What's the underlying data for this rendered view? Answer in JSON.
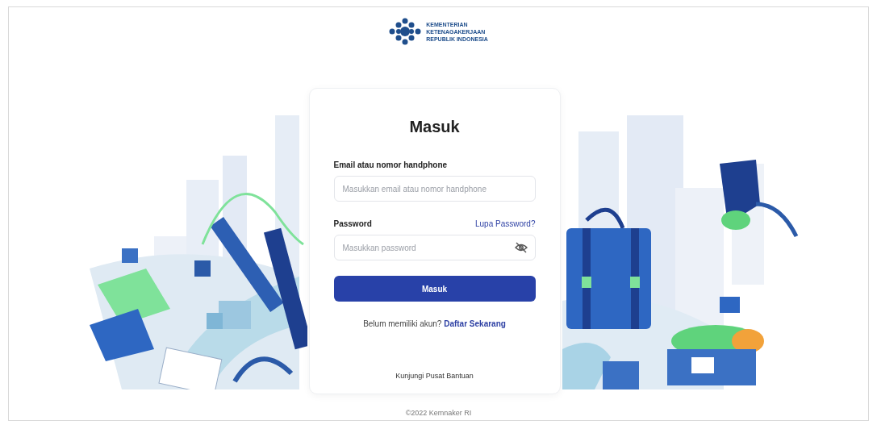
{
  "header": {
    "logo_text": [
      "KEMENTERIAN",
      "KETENAGAKERJAAN",
      "REPUBLIK INDONESIA"
    ]
  },
  "login": {
    "title": "Masuk",
    "fields": [
      {
        "kind": "text",
        "label": "Email atau nomor handphone",
        "placeholder": "Masukkan email atau nomor handphone"
      },
      {
        "kind": "password",
        "label": "Password",
        "link": "Lupa Password?",
        "placeholder": "Masukkan password"
      }
    ],
    "submit": "Masuk",
    "register_prompt": "Belum memiliki akun?",
    "register_link": "Daftar Sekarang",
    "help_link": "Kunjungi Pusat Bantuan"
  },
  "footer": {
    "copyright": "©2022 Kemnaker RI"
  }
}
